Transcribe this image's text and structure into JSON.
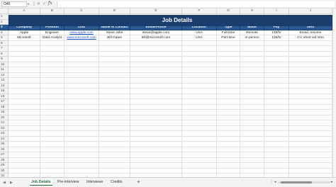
{
  "formula_bar": {
    "name_box": "O46",
    "fx_label": "fx",
    "formula": ""
  },
  "columns": [
    "A",
    "B",
    "C",
    "D",
    "E",
    "F",
    "G",
    "H",
    "I",
    "J"
  ],
  "row_numbers": [
    "1",
    "2",
    "3",
    "4",
    "5",
    "6",
    "7",
    "8",
    "9",
    "10",
    "11",
    "12",
    "13",
    "14",
    "15",
    "16",
    "17",
    "18",
    "19",
    "20",
    "21",
    "22",
    "23",
    "24",
    "25",
    "26",
    "27",
    "28",
    "29",
    "30",
    "31"
  ],
  "sheet": {
    "title": "Job Details",
    "headers": [
      "Company",
      "Position",
      "Link",
      "Name of Contact",
      "Email/Phone",
      "Location",
      "Type",
      "Mode",
      "Pay",
      "Sent"
    ],
    "rows": [
      [
        "Apple",
        "Engineer",
        "www.apple.com",
        "Steve Jobs",
        "steve@apple.com",
        "USA",
        "Full-time",
        "Remote",
        "135/hr",
        "Email, resume"
      ],
      [
        "Microsoft",
        "Data Analyst",
        "www.microsoft.com",
        "Bill Gates",
        "bill@microsoft.com",
        "USA",
        "Part-time",
        "In-person",
        "125/hr",
        "CV, short vid intro"
      ]
    ]
  },
  "tabs": {
    "items": [
      "Job Details",
      "Pre-Interview",
      "Interviews",
      "Credits"
    ],
    "active": "Job Details",
    "add_label": "+"
  },
  "colors": {
    "title_band": "#1a3d6d",
    "header_band": "#2b5a8f",
    "link": "#1a55c4",
    "active_tab": "#1a6b32"
  }
}
